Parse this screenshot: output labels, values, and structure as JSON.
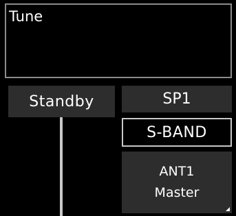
{
  "tune": {
    "label": "Tune"
  },
  "standby": {
    "label": "Standby"
  },
  "controls": {
    "sp1_label": "SP1",
    "band_label": "S-BAND",
    "antenna_line1": "ANT1",
    "antenna_line2": "Master"
  },
  "colors": {
    "background": "#000000",
    "button_fill": "#2d2d2d",
    "border": "#c8c8c8",
    "text": "#ffffff"
  },
  "icons": {
    "antenna_corner": "dropdown-corner-icon"
  }
}
